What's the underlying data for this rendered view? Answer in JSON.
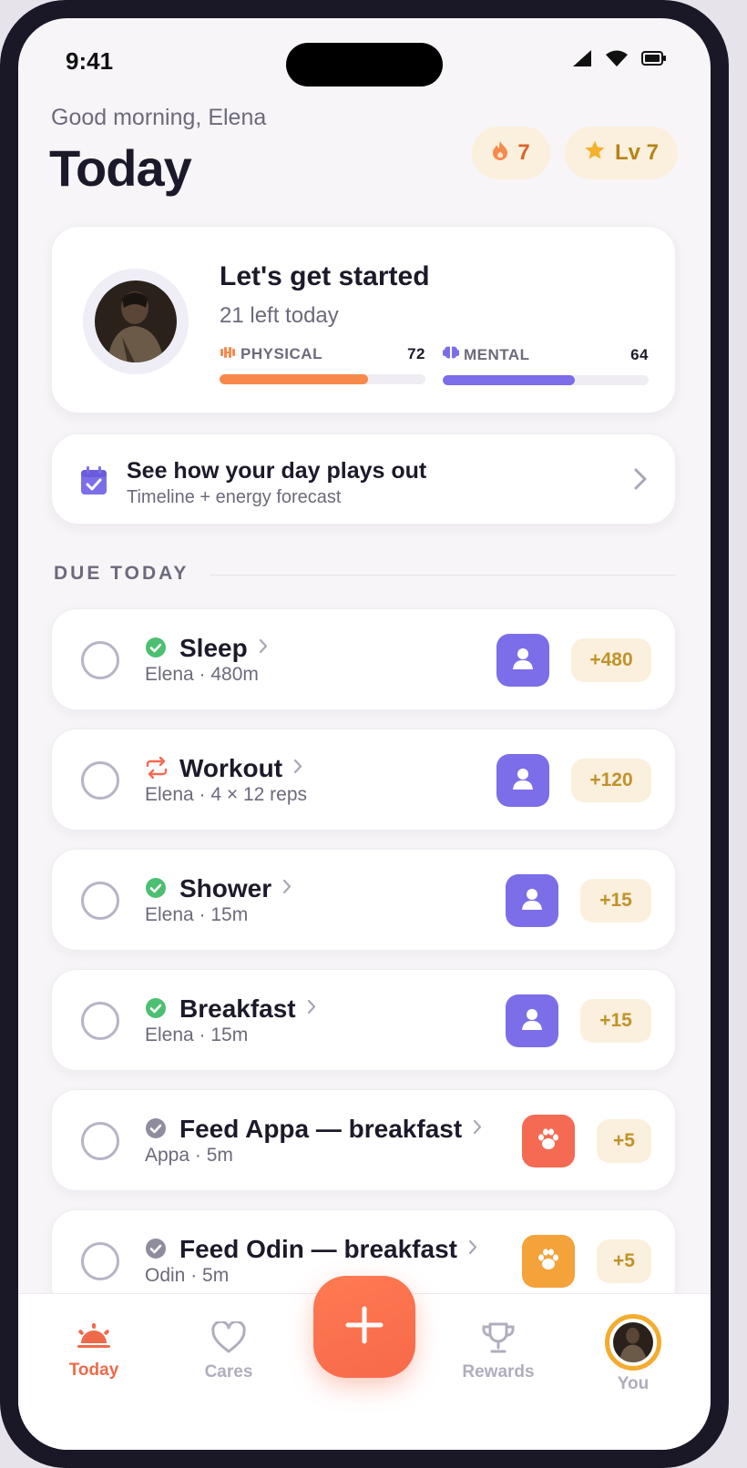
{
  "status_bar": {
    "time": "9:41"
  },
  "header": {
    "greeting": "Good morning, Elena",
    "title": "Today",
    "streak": "7",
    "level": "Lv 7"
  },
  "summary": {
    "title": "Let's get started",
    "subtitle": "21 left today",
    "physical": {
      "label": "PHYSICAL",
      "value": "72",
      "fill_percent": 72
    },
    "mental": {
      "label": "MENTAL",
      "value": "64",
      "fill_percent": 64
    }
  },
  "forecast": {
    "title": "See how your day plays out",
    "subtitle": "Timeline + energy forecast"
  },
  "section": {
    "due_today": "DUE TODAY"
  },
  "tasks": [
    {
      "name": "Sleep",
      "meta": "Elena · 480m",
      "points": "+480",
      "status_icon": "check-circle-icon",
      "assignee_icon": "person-icon",
      "assignee_color": "#7b6ee8"
    },
    {
      "name": "Workout",
      "meta": "Elena · 4 × 12 reps",
      "points": "+120",
      "status_icon": "repeat-icon",
      "assignee_icon": "person-icon",
      "assignee_color": "#7b6ee8"
    },
    {
      "name": "Shower",
      "meta": "Elena · 15m",
      "points": "+15",
      "status_icon": "check-circle-icon",
      "assignee_icon": "person-icon",
      "assignee_color": "#7b6ee8"
    },
    {
      "name": "Breakfast",
      "meta": "Elena · 15m",
      "points": "+15",
      "status_icon": "check-circle-icon",
      "assignee_icon": "person-icon",
      "assignee_color": "#7b6ee8"
    },
    {
      "name": "Feed Appa — breakfast",
      "meta": "Appa · 5m",
      "points": "+5",
      "status_icon": "check-circle-grey-icon",
      "assignee_icon": "paw-icon",
      "assignee_color": "#f56a52"
    },
    {
      "name": "Feed Odin — breakfast",
      "meta": "Odin · 5m",
      "points": "+5",
      "status_icon": "check-circle-grey-icon",
      "assignee_icon": "paw-icon",
      "assignee_color": "#f4a23a"
    }
  ],
  "nav": {
    "today": "Today",
    "cares": "Cares",
    "rewards": "Rewards",
    "you": "You"
  },
  "colors": {
    "accent": "#ef6a4a",
    "physical": "#f7894c",
    "mental": "#7b6ee8",
    "success": "#4cbf70",
    "points_bg": "#fbf0dd"
  }
}
